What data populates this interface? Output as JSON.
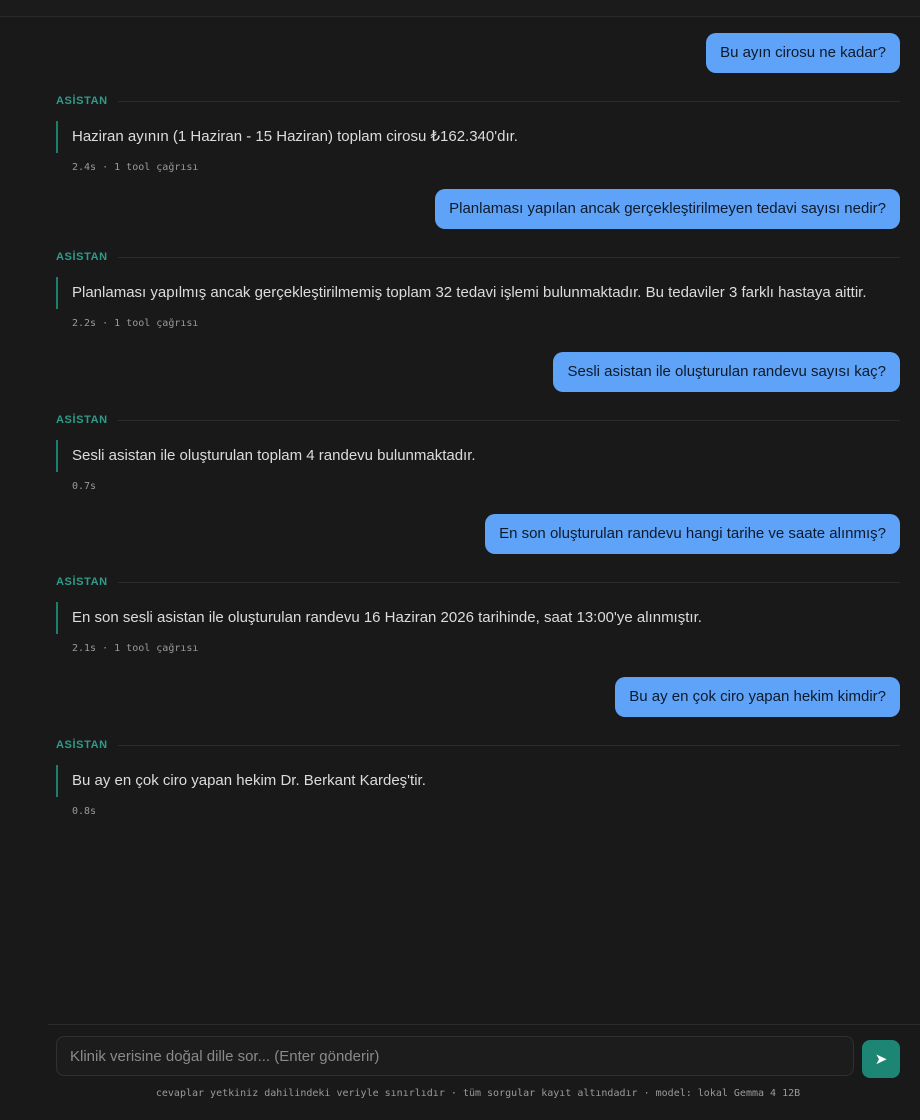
{
  "messages": [
    {
      "role": "user",
      "text": "Bu ayın cirosu ne kadar?"
    },
    {
      "role": "assistant",
      "label": "ASİSTAN",
      "text": "Haziran ayının (1 Haziran - 15 Haziran) toplam cirosu ₺162.340'dır.",
      "meta": "2.4s · 1 tool çağrısı"
    },
    {
      "role": "user",
      "text": "Planlaması yapılan ancak gerçekleştirilmeyen tedavi sayısı nedir?"
    },
    {
      "role": "assistant",
      "label": "ASİSTAN",
      "text": "Planlaması yapılmış ancak gerçekleştirilmemiş toplam 32 tedavi işlemi bulunmaktadır. Bu tedaviler 3 farklı hastaya aittir.",
      "meta": "2.2s · 1 tool çağrısı"
    },
    {
      "role": "user",
      "text": "Sesli asistan ile oluşturulan randevu sayısı kaç?"
    },
    {
      "role": "assistant",
      "label": "ASİSTAN",
      "text": "Sesli asistan ile oluşturulan toplam 4 randevu bulunmaktadır.",
      "meta": "0.7s"
    },
    {
      "role": "user",
      "text": "En son oluşturulan randevu hangi tarihe ve saate alınmış?"
    },
    {
      "role": "assistant",
      "label": "ASİSTAN",
      "text": "En son sesli asistan ile oluşturulan randevu 16 Haziran 2026 tarihinde, saat 13:00'ye alınmıştır.",
      "meta": "2.1s · 1 tool çağrısı"
    },
    {
      "role": "user",
      "text": "Bu ay en çok ciro yapan hekim kimdir?"
    },
    {
      "role": "assistant",
      "label": "ASİSTAN",
      "text": "Bu ay en çok ciro yapan hekim Dr. Berkant Kardeş'tir.",
      "meta": "0.8s"
    }
  ],
  "composer": {
    "placeholder": "Klinik verisine doğal dille sor... (Enter gönderir)",
    "send_icon": "➤"
  },
  "footer": {
    "part1": "cevaplar yetkiniz dahilindeki veriyle sınırlıdır",
    "separator": "·",
    "part2": "tüm sorgular kayıt altındadır",
    "separator2": "·",
    "part3": "model: lokal Gemma 4 12B"
  },
  "colors": {
    "user_bubble": "#5ea3f7",
    "assistant_accent": "#1f7d6e",
    "send_button": "#1d8574"
  }
}
